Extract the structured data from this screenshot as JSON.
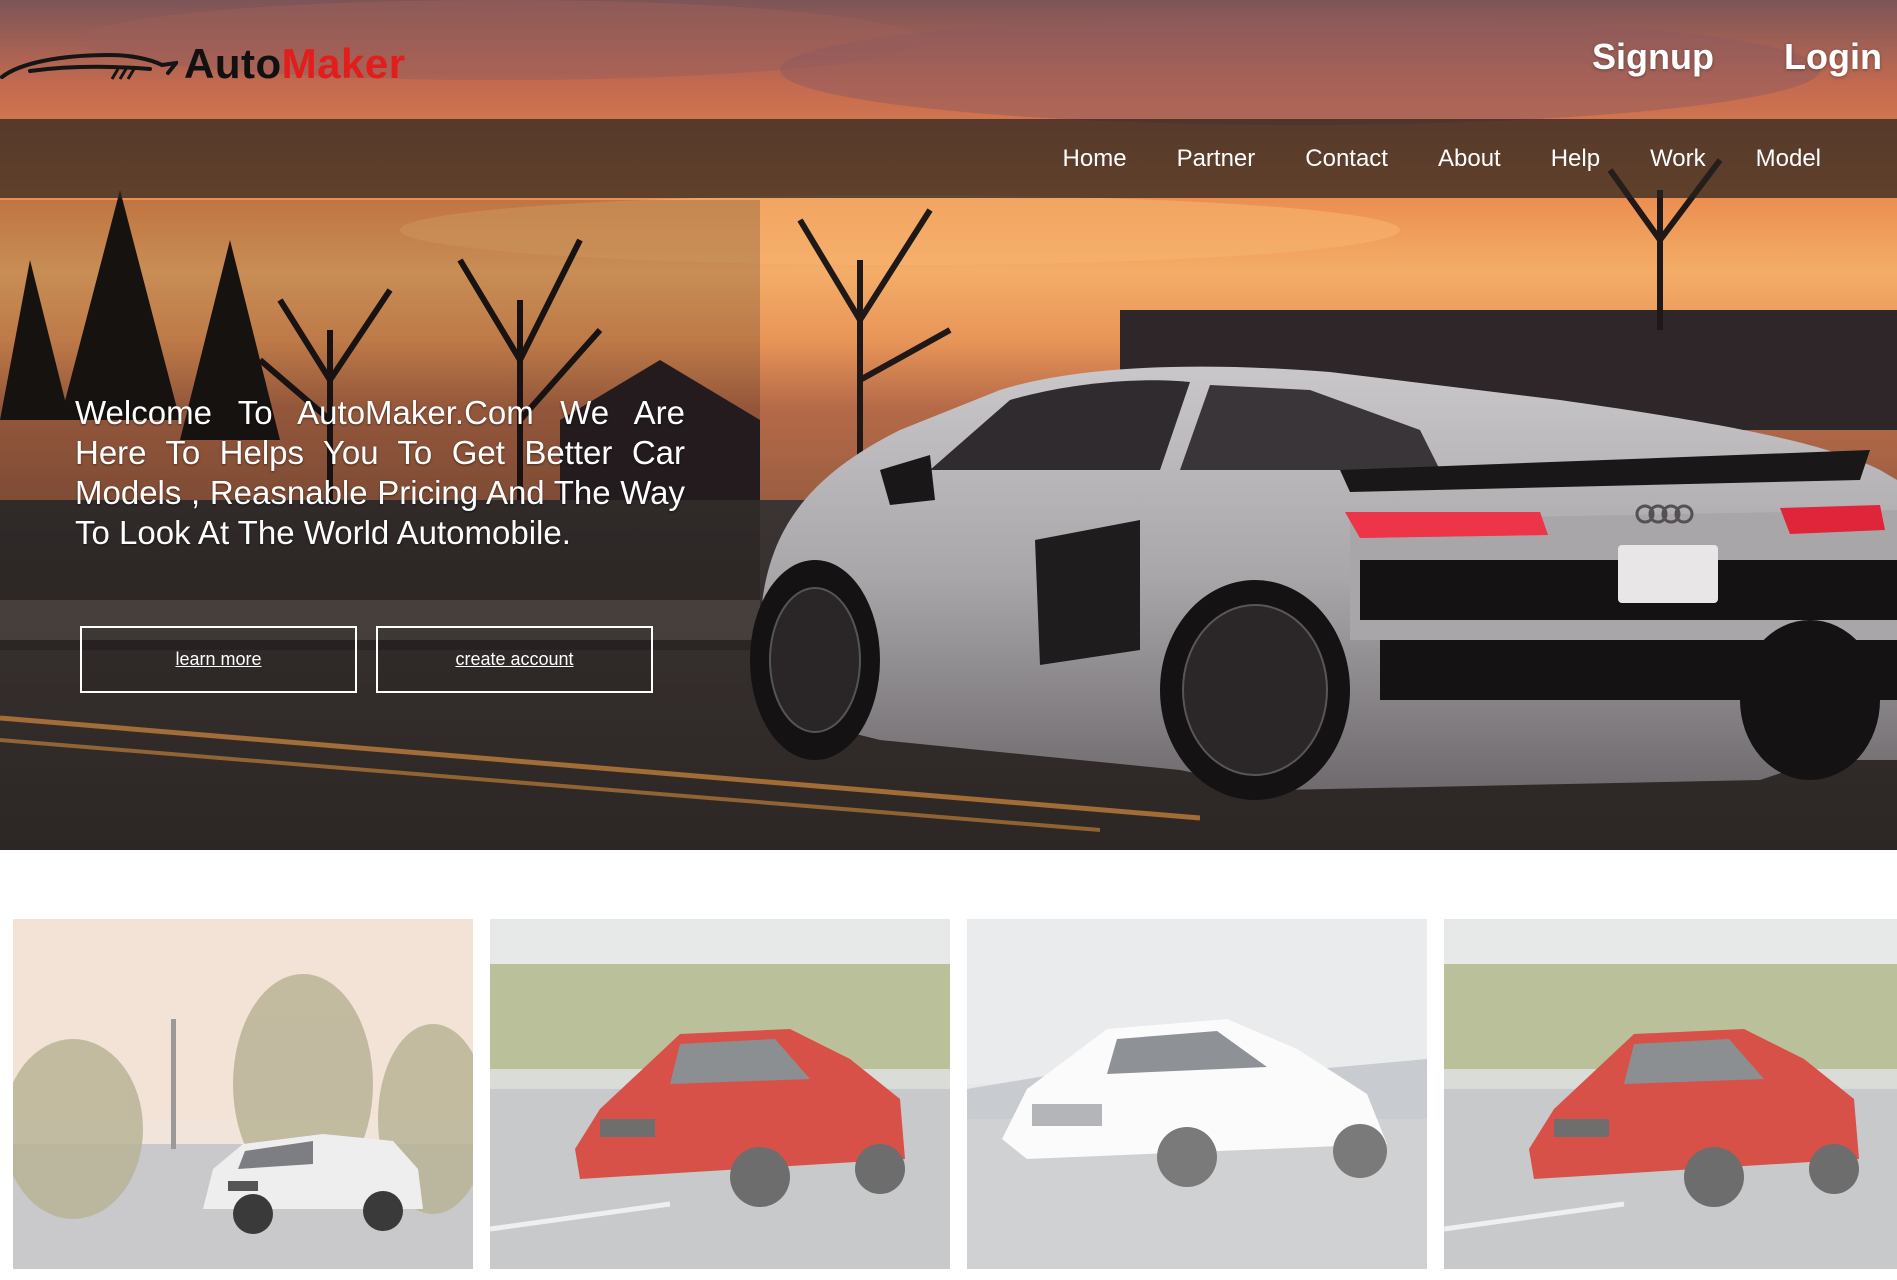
{
  "brand": {
    "part1": "Auto",
    "part2": "Maker"
  },
  "auth": {
    "signup": "Signup",
    "login": "Login"
  },
  "nav": {
    "items": [
      "Home",
      "Partner",
      "Contact",
      "About",
      "Help",
      "Work",
      "Model"
    ]
  },
  "hero": {
    "welcome": "Welcome To AutoMaker.Com We Are Here To Helps You To Get Better Car Models , Reasnable Pricing And The Way To Look At The World Automobile.",
    "learn_more": "learn more",
    "create_account": "create account"
  },
  "colors": {
    "brand_red": "#e31c1c",
    "nav_bg": "#28221e",
    "text_light": "#ffffff"
  },
  "gallery": [
    {
      "car": "white-wagon"
    },
    {
      "car": "red-coupe"
    },
    {
      "car": "white-coupe"
    },
    {
      "car": "red-coupe"
    }
  ]
}
